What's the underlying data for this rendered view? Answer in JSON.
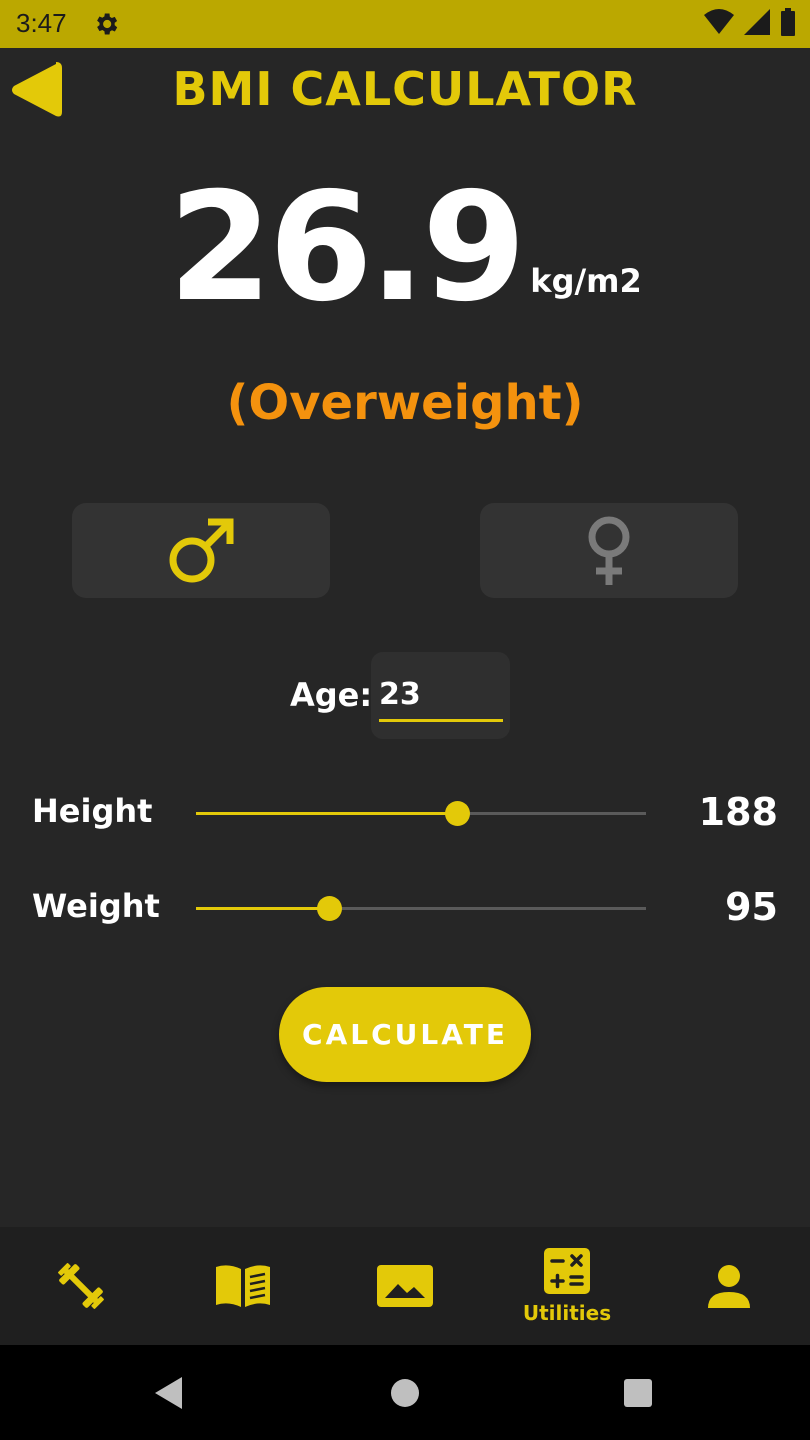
{
  "status_bar": {
    "time": "3:47"
  },
  "header": {
    "title": "BMI CALCULATOR"
  },
  "result": {
    "bmi": "26.9",
    "unit": "kg/m2",
    "category": "(Overweight)"
  },
  "gender": {
    "selected": "male"
  },
  "age": {
    "label": "Age:",
    "value": "23"
  },
  "height": {
    "label": "Height",
    "value": "188",
    "fraction": 0.58
  },
  "weight": {
    "label": "Weight",
    "value": "95",
    "fraction": 0.296
  },
  "calculate_button": {
    "label": "CALCULATE"
  },
  "bottom_nav": {
    "items": [
      {
        "icon": "dumbbell-icon",
        "label": ""
      },
      {
        "icon": "book-icon",
        "label": ""
      },
      {
        "icon": "image-icon",
        "label": ""
      },
      {
        "icon": "calculator-icon",
        "label": "Utilities",
        "active": true
      },
      {
        "icon": "person-icon",
        "label": ""
      }
    ]
  },
  "colors": {
    "accent": "#e3c909",
    "category": "#f4920e",
    "background": "#262626",
    "status_bar": "#bba800"
  }
}
